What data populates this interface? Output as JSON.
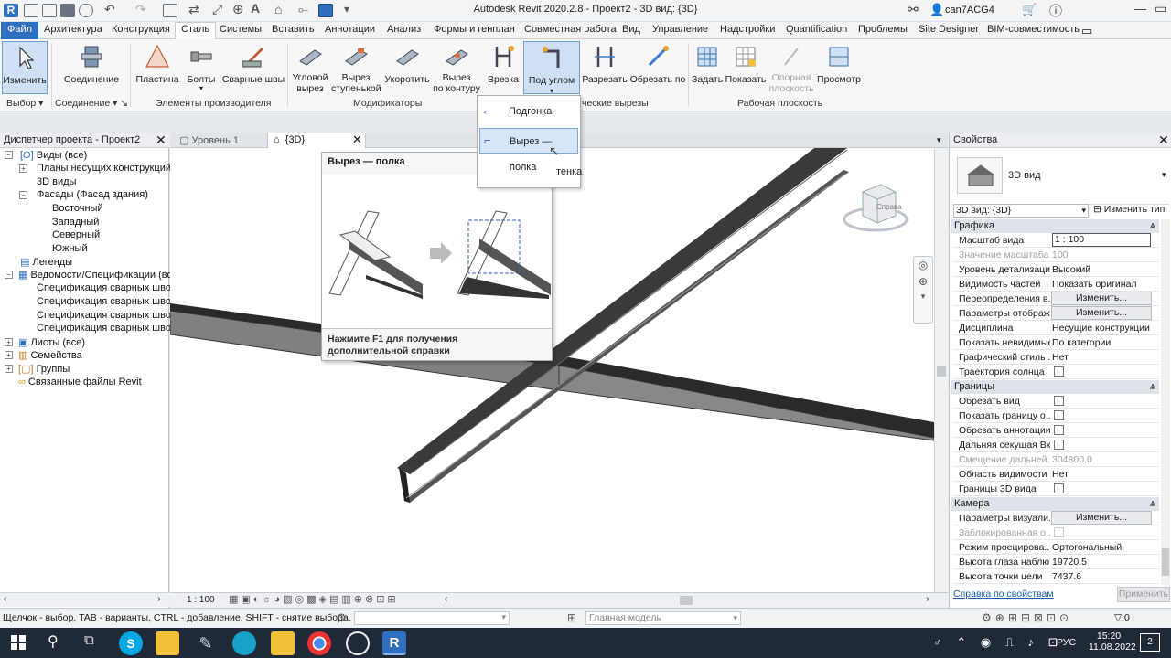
{
  "window": {
    "title": "Autodesk Revit 2020.2.8 - Проект2 - 3D вид: {3D}",
    "user": "can7ACG4"
  },
  "ribbon_tabs": [
    "Файл",
    "Архитектура",
    "Конструкция",
    "Сталь",
    "Системы",
    "Вставить",
    "Аннотации",
    "Анализ",
    "Формы и генплан",
    "Совместная работа",
    "Вид",
    "Управление",
    "Надстройки",
    "Quantification",
    "Проблемы",
    "Site Designer",
    "BIM-совместимость"
  ],
  "ribbon_buttons": {
    "modify": "Изменить",
    "connection": "Соединение",
    "plate": "Пластина",
    "bolts": "Болты",
    "welds": "Сварные швы",
    "corner_cut_1": "Угловой",
    "corner_cut_2": "вырез",
    "cope_1": "Вырез",
    "cope_2": "ступенькой",
    "shorten": "Укоротить",
    "contour_1": "Вырез",
    "contour_2": "по контуру",
    "notch": "Врезка",
    "miter_1": "Под углом",
    "cut": "Разрезать",
    "cut_by": "Обрезать по",
    "set": "Задать",
    "show": "Показать",
    "ref_plane_1": "Опорная",
    "ref_plane_2": "плоскость",
    "viewer": "Просмотр"
  },
  "ribbon_groups": {
    "select": "Выбор",
    "connection": "Соединение",
    "fab_elements": "Элементы производителя",
    "modifiers": "Модификаторы",
    "param_cuts": "ческие вырезы",
    "work_plane": "Рабочая плоскость"
  },
  "dropdown": {
    "item1": "Подгонка",
    "item2": "Вырез — полка",
    "item3": "тенка"
  },
  "tooltip": {
    "title": "Вырез — полка",
    "help": "Нажмите F1 для получения дополнительной справки"
  },
  "project_browser": {
    "title": "Диспетчер проекта - Проект2",
    "items": [
      "Виды (все)",
      "Планы несущих конструкций",
      "3D виды",
      "Фасады (Фасад здания)",
      "Восточный",
      "Западный",
      "Северный",
      "Южный",
      "Легенды",
      "Ведомости/Спецификации (все",
      "Спецификация сварных швов",
      "Спецификация сварных швов",
      "Спецификация сварных швов",
      "Спецификация сварных швов",
      "Листы (все)",
      "Семейства",
      "Группы",
      "Связанные файлы Revit"
    ]
  },
  "view_tabs": {
    "tab1": "Уровень 1",
    "tab2": "{3D}"
  },
  "viewcube_label": "Справа",
  "view_scale": "1 : 100",
  "properties": {
    "title": "Свойства",
    "type_name": "3D вид",
    "selector": "3D вид: {3D}",
    "edit_type": "Изменить тип",
    "groups": {
      "graphics": "Графика",
      "extents": "Границы",
      "camera": "Камера"
    },
    "rows_graphics": [
      {
        "n": "Масштаб вида",
        "v": "1 : 100",
        "kind": "input"
      },
      {
        "n": "Значение масштаба",
        "v": "100",
        "kind": "dis"
      },
      {
        "n": "Уровень детализации",
        "v": "Высокий",
        "kind": "text"
      },
      {
        "n": "Видимость частей",
        "v": "Показать оригинал",
        "kind": "text"
      },
      {
        "n": "Переопределения в...",
        "v": "Изменить...",
        "kind": "btn"
      },
      {
        "n": "Параметры отображ...",
        "v": "Изменить...",
        "kind": "btn"
      },
      {
        "n": "Дисциплина",
        "v": "Несущие конструкции",
        "kind": "text"
      },
      {
        "n": "Показать невидимые",
        "v": "По категории",
        "kind": "text"
      },
      {
        "n": "Графический стиль ...",
        "v": "Нет",
        "kind": "text"
      },
      {
        "n": "Траектория солнца",
        "v": "",
        "kind": "check"
      }
    ],
    "rows_extents": [
      {
        "n": "Обрезать вид",
        "v": "",
        "kind": "check"
      },
      {
        "n": "Показать границу о...",
        "v": "",
        "kind": "check"
      },
      {
        "n": "Обрезать аннотации",
        "v": "",
        "kind": "check"
      },
      {
        "n": "Дальняя секущая Вкл",
        "v": "",
        "kind": "check"
      },
      {
        "n": "Смещение дальней...",
        "v": "304800.0",
        "kind": "dis"
      },
      {
        "n": "Область видимости",
        "v": "Нет",
        "kind": "text"
      },
      {
        "n": "Границы 3D вида",
        "v": "",
        "kind": "check"
      }
    ],
    "rows_camera": [
      {
        "n": "Параметры визуали...",
        "v": "Изменить...",
        "kind": "btn"
      },
      {
        "n": "Заблокированная о...",
        "v": "",
        "kind": "discheck"
      },
      {
        "n": "Режим проецирова...",
        "v": "Ортогональный",
        "kind": "text"
      },
      {
        "n": "Высота глаза наблю...",
        "v": "19720.5",
        "kind": "text"
      },
      {
        "n": "Высота точки цели",
        "v": "7437.6",
        "kind": "text"
      }
    ],
    "help_link": "Справка по свойствам",
    "apply": "Применить"
  },
  "status": {
    "text": "Щелчок - выбор, TAB - варианты, CTRL - добавление, SHIFT - снятие выбора.",
    "model": "Главная модель",
    "count": ":0"
  },
  "taskbar": {
    "lang": "РУС",
    "time": "15:20",
    "date": "11.08.2022",
    "notif": "2"
  },
  "colors": {
    "accent": "#2e6fbf",
    "taskbar": "#1f2a36"
  }
}
